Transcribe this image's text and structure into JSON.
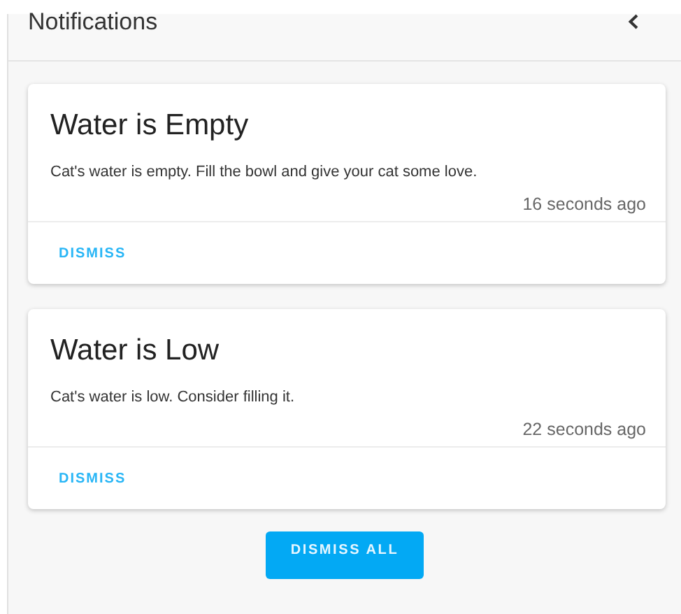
{
  "header": {
    "title": "Notifications"
  },
  "notifications": [
    {
      "title": "Water is Empty",
      "message": "Cat's water is empty. Fill the bowl and give your cat some love.",
      "time": "16 seconds ago",
      "action": "DISMISS"
    },
    {
      "title": "Water is Low",
      "message": "Cat's water is low. Consider filling it.",
      "time": "22 seconds ago",
      "action": "DISMISS"
    }
  ],
  "dismiss_all": "DISMISS ALL"
}
